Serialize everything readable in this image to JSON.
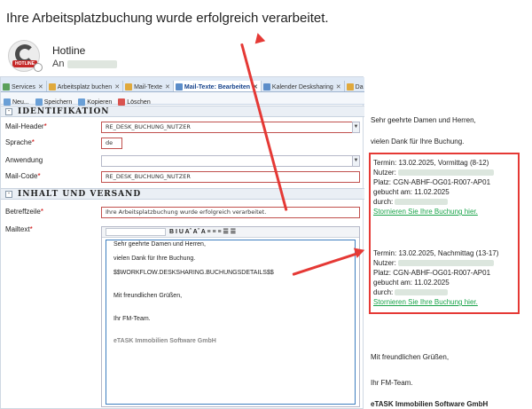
{
  "headline": "Ihre Arbeitsplatzbuchung wurde erfolgreich verarbeitet.",
  "sender": {
    "name": "Hotline",
    "to_label": "An",
    "avatar_tag": "HOTLINE"
  },
  "tabs": [
    {
      "label": "Services",
      "icon": "grid-icon",
      "color": "#5aa05a",
      "active": false
    },
    {
      "label": "Arbeitsplatz buchen",
      "icon": "calendar-icon",
      "color": "#e0a93c",
      "active": false
    },
    {
      "label": "Mail-Texte",
      "icon": "mail-icon",
      "color": "#e0a93c",
      "active": false
    },
    {
      "label": "Mail-Texte: Bearbeiten",
      "icon": "mail-edit-icon",
      "color": "#5b8dc9",
      "active": true
    },
    {
      "label": "Kalender Desksharing",
      "icon": "calendar-icon",
      "color": "#5b8dc9",
      "active": false
    },
    {
      "label": "Da",
      "icon": "folder-icon",
      "color": "#e0a93c",
      "active": false
    }
  ],
  "toolbar": {
    "new": "Neu...",
    "save": "Speichern",
    "copy": "Kopieren",
    "delete": "Löschen"
  },
  "section_identifikation": {
    "title": "IDENTIFIKATION",
    "toggle": "-"
  },
  "section_inhalt": {
    "title": "INHALT UND VERSAND",
    "toggle": "-"
  },
  "form": {
    "mail_header_label": "Mail-Header",
    "mail_header_value": "RE_DESK_BUCHUNG_NUTZER",
    "sprache_label": "Sprache",
    "sprache_value": "de",
    "anwendung_label": "Anwendung",
    "anwendung_value": "",
    "mail_code_label": "Mail-Code",
    "mail_code_value": "RE_DESK_BUCHUNG_NUTZER",
    "betreff_label": "Betreffzeile",
    "betreff_value": "Ihre Arbeitsplatzbuchung wurde erfolgreich verarbeitet.",
    "mailtext_label": "Mailtext",
    "required_mark": "*"
  },
  "editor": {
    "tools": "B  I  U  Aˆ  Aˇ  A  ≡  ≡  ≡  ☰  ☰",
    "lines": [
      "Sehr geehrte Damen und Herren,",
      "vielen Dank für Ihre Buchung.",
      "$$WORKFLOW.DESKSHARING.BUCHUNGSDETAILS$$",
      "Mit freundlichen Grüßen,",
      "Ihr FM-Team.",
      "eTASK Immobilien Software GmbH"
    ]
  },
  "preview": {
    "greeting": "Sehr geehrte Damen und Herren,",
    "thanks": "vielen Dank für Ihre Buchung.",
    "bookings": [
      {
        "termin": "Termin: 13.02.2025, Vormittag (8-12)",
        "nutzer_label": "Nutzer:",
        "platz": "Platz: CGN-ABHF-OG01-R007-AP01",
        "gebucht": "gebucht am: 11.02.2025",
        "durch_label": "durch:",
        "storno": "Stornieren Sie Ihre Buchung hier."
      },
      {
        "termin": "Termin: 13.02.2025, Nachmittag (13-17)",
        "nutzer_label": "Nutzer:",
        "platz": "Platz: CGN-ABHF-OG01-R007-AP01",
        "gebucht": "gebucht am: 11.02.2025",
        "durch_label": "durch:",
        "storno": "Stornieren Sie Ihre Buchung hier."
      }
    ],
    "closing": "Mit freundlichen Grüßen,",
    "team": "Ihr FM-Team.",
    "company": "eTASK Immobilien Software GmbH"
  },
  "colors": {
    "accent_red": "#e53935",
    "link_green": "#1aa34a",
    "required_red": "#c00000"
  }
}
